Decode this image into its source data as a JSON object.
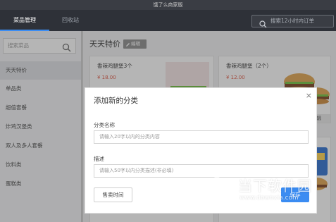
{
  "app": {
    "window_title": "饿了么商家版"
  },
  "top_nav": {
    "tabs": [
      {
        "label": "菜品管理"
      },
      {
        "label": "回收站"
      }
    ],
    "search_placeholder": "搜索12小时内订单"
  },
  "sidebar": {
    "search_placeholder": "搜索菜品",
    "items": [
      {
        "label": "天天特价"
      },
      {
        "label": "单品类"
      },
      {
        "label": "超值套餐"
      },
      {
        "label": "炸鸡汉堡类"
      },
      {
        "label": "双人及多人套餐"
      },
      {
        "label": "饮料类"
      },
      {
        "label": "蛋糕类"
      }
    ]
  },
  "main": {
    "category_title": "天天特价",
    "edit_label": "编辑",
    "cards": [
      {
        "name": "香辣鸡腿堡3个",
        "price": "¥ 18.00"
      },
      {
        "name": "香辣鸡腿堡（2个）",
        "price": "¥ 12.00"
      }
    ],
    "card_edit_label": "编辑"
  },
  "dialog": {
    "title": "添加新的分类",
    "close": "×",
    "name_label": "分类名称",
    "name_placeholder": "请输入20字以内的分类内容",
    "desc_label": "描述",
    "desc_placeholder": "请输入50字以内分类描述(非必填)",
    "sale_time_label": "售卖时间",
    "save_label": "保存"
  },
  "watermark": {
    "text": "当下软件园",
    "url": "www.downxia.com"
  },
  "colors": {
    "accent": "#3b8cf2",
    "price": "#e0543f",
    "nav_bg": "#2e3138"
  }
}
